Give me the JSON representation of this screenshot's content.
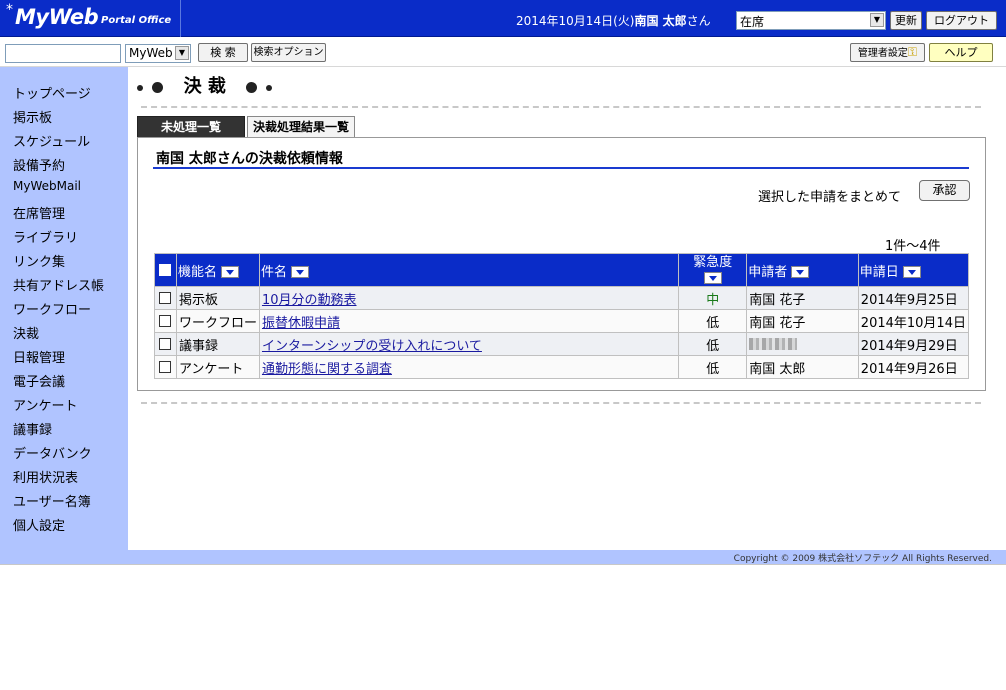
{
  "header": {
    "logo_mark": "*",
    "logo_main": "MyWeb",
    "logo_sub": "Portal Office",
    "date": "2014年10月14日(火)",
    "user": "南国 太郎",
    "user_suffix": "さん",
    "presence_value": "在席",
    "update_label": "更新",
    "logout_label": "ログアウト"
  },
  "searchbar": {
    "query": "",
    "scope_value": "MyWeb",
    "search_label": "検 索",
    "search_options_label": "検索オプション",
    "admin_label": "管理者設定",
    "help_label": "ヘルプ"
  },
  "sidebar": {
    "items": [
      {
        "label": "トップページ"
      },
      {
        "label": "掲示板"
      },
      {
        "label": "スケジュール"
      },
      {
        "label": "設備予約"
      },
      {
        "label": "MyWebMail"
      },
      {
        "label": "在席管理"
      },
      {
        "label": "ライブラリ"
      },
      {
        "label": "リンク集"
      },
      {
        "label": "共有アドレス帳"
      },
      {
        "label": "ワークフロー"
      },
      {
        "label": "決裁"
      },
      {
        "label": "日報管理"
      },
      {
        "label": "電子会議"
      },
      {
        "label": "アンケート"
      },
      {
        "label": "議事録"
      },
      {
        "label": "データバンク"
      },
      {
        "label": "利用状況表"
      },
      {
        "label": "ユーザー名簿"
      },
      {
        "label": "個人設定"
      }
    ]
  },
  "main": {
    "page_title": "決 裁",
    "tabs": [
      {
        "label": "未処理一覧"
      },
      {
        "label": "決裁処理結果一覧"
      }
    ],
    "panel_title": "南国 太郎さんの決裁依頼情報",
    "bulk_text": "選択した申請をまとめて",
    "approve_label": "承認",
    "count_text": "1件〜4件",
    "columns": {
      "function": "機能名",
      "subject": "件名",
      "urgency": "緊急度",
      "applicant": "申請者",
      "date": "申請日"
    },
    "rows": [
      {
        "function": "掲示板",
        "subject": "10月分の勤務表",
        "urgency": "中",
        "applicant": "南国 花子",
        "date": "2014年9月25日",
        "urgency_color": "#1a7a1a"
      },
      {
        "function": "ワークフロー",
        "subject": "振替休暇申請",
        "urgency": "低",
        "applicant": "南国 花子",
        "date": "2014年10月14日",
        "urgency_color": "#000000"
      },
      {
        "function": "議事録",
        "subject": "インターンシップの受け入れについて",
        "urgency": "低",
        "applicant": "",
        "date": "2014年9月29日",
        "urgency_color": "#000000"
      },
      {
        "function": "アンケート",
        "subject": "通勤形態に関する調査",
        "urgency": "低",
        "applicant": "南国 太郎",
        "date": "2014年9月26日",
        "urgency_color": "#000000"
      }
    ]
  },
  "footer": {
    "copyright": "Copyright © 2009 株式会社ソフテック All Rights Reserved."
  },
  "colors": {
    "brand_blue": "#0a2cc8",
    "sidebar_bg": "#b0c4ff"
  }
}
